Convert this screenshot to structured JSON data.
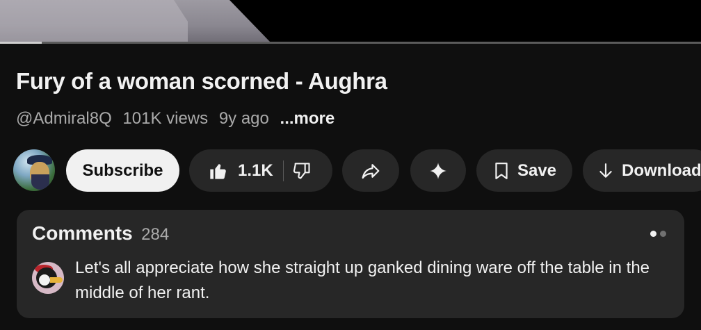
{
  "video": {
    "progress": 0.06
  },
  "title": "Fury of a woman scorned - Aughra",
  "meta": {
    "channel": "@Admiral8Q",
    "views": "101K views",
    "age": "9y ago",
    "more": "...more"
  },
  "actions": {
    "subscribe": "Subscribe",
    "like_count": "1.1K",
    "save": "Save",
    "download": "Download"
  },
  "comments": {
    "title": "Comments",
    "count": "284",
    "top_comment": "Let's all appreciate how she straight up ganked dining ware off the table in the middle of her rant."
  },
  "icons": {
    "like": "thumbs-up-icon",
    "dislike": "thumbs-down-icon",
    "share": "share-icon",
    "ask": "sparkle-icon",
    "save": "bookmark-icon",
    "download": "download-arrow-icon"
  },
  "colors": {
    "background": "#0f0f0f",
    "pill": "#272727",
    "text": "#f1f1f1",
    "muted": "#aaaaaa"
  }
}
